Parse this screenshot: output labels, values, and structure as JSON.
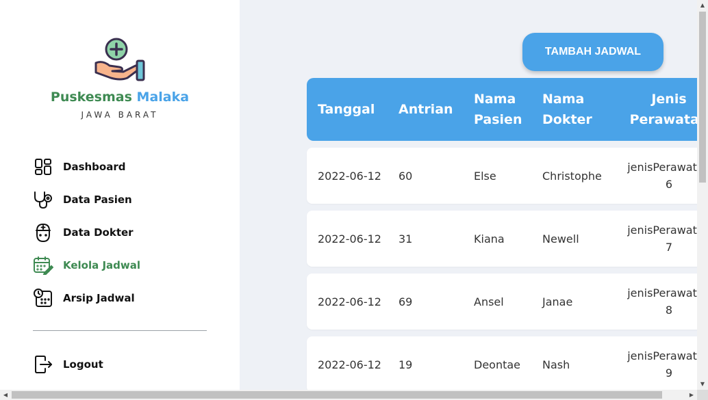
{
  "brand": {
    "name_part1": "Puskesmas",
    "name_part2": "Malaka",
    "region": "JAWA BARAT"
  },
  "colors": {
    "accent": "#4aa3e8",
    "brand_green": "#3e8a52",
    "background": "#eef1f6"
  },
  "sidebar": {
    "items": [
      {
        "label": "Dashboard",
        "icon": "dashboard-icon",
        "active": false
      },
      {
        "label": "Data Pasien",
        "icon": "stethoscope-icon",
        "active": false
      },
      {
        "label": "Data Dokter",
        "icon": "doctor-icon",
        "active": false
      },
      {
        "label": "Kelola Jadwal",
        "icon": "calendar-edit-icon",
        "active": true
      },
      {
        "label": "Arsip Jadwal",
        "icon": "clock-calendar-icon",
        "active": false
      }
    ],
    "logout": {
      "label": "Logout",
      "icon": "logout-icon"
    }
  },
  "actions": {
    "add_schedule": "TAMBAH JADWAL"
  },
  "table": {
    "headers": [
      {
        "line1": "Tanggal",
        "line2": ""
      },
      {
        "line1": "Antrian",
        "line2": ""
      },
      {
        "line1": "Nama",
        "line2": "Pasien"
      },
      {
        "line1": "Nama",
        "line2": "Dokter"
      },
      {
        "line1": "Jenis",
        "line2": "Perawatan"
      }
    ],
    "rows": [
      {
        "tanggal": "2022-06-12",
        "antrian": "60",
        "pasien": "Else",
        "dokter": "Christophe",
        "jenis_a": "jenisPerawatan",
        "jenis_b": "6"
      },
      {
        "tanggal": "2022-06-12",
        "antrian": "31",
        "pasien": "Kiana",
        "dokter": "Newell",
        "jenis_a": "jenisPerawatan",
        "jenis_b": "7"
      },
      {
        "tanggal": "2022-06-12",
        "antrian": "69",
        "pasien": "Ansel",
        "dokter": "Janae",
        "jenis_a": "jenisPerawatan",
        "jenis_b": "8"
      },
      {
        "tanggal": "2022-06-12",
        "antrian": "19",
        "pasien": "Deontae",
        "dokter": "Nash",
        "jenis_a": "jenisPerawatan",
        "jenis_b": "9"
      }
    ]
  }
}
